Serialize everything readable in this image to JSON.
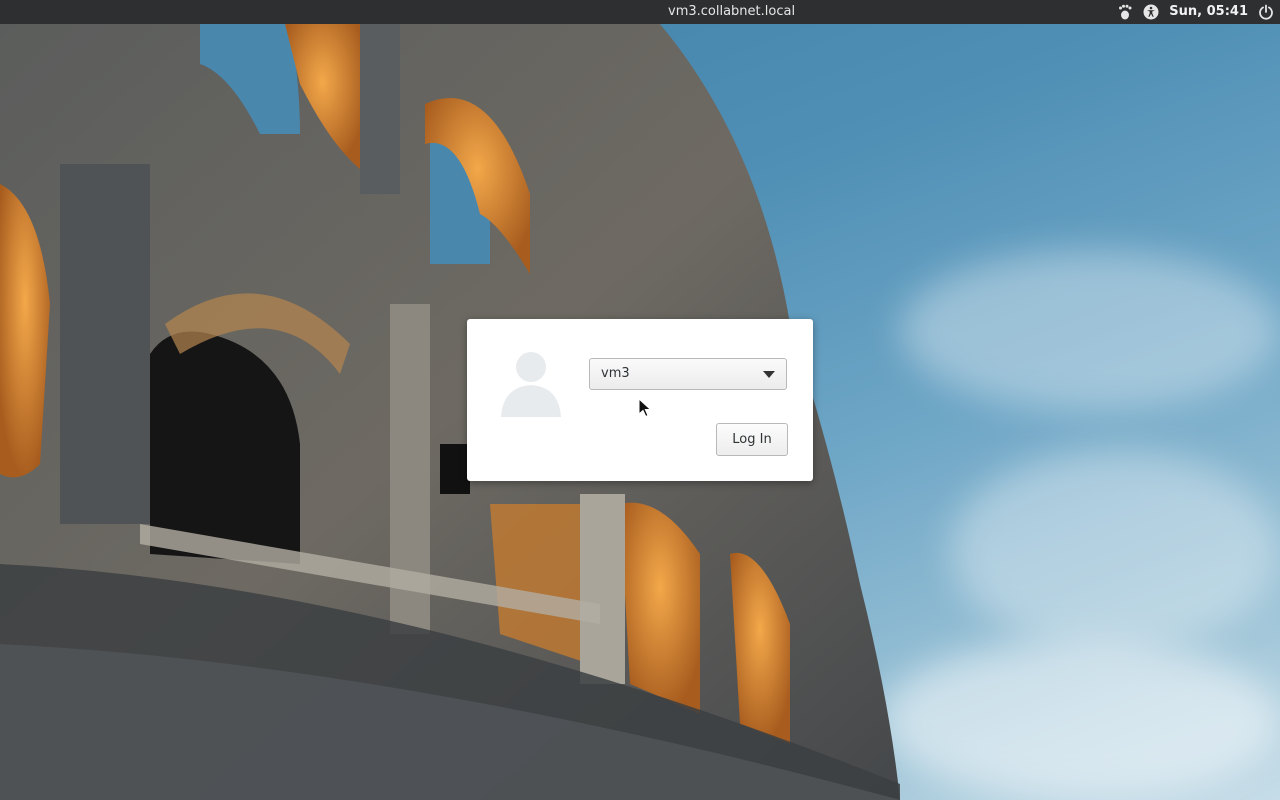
{
  "topbar": {
    "hostname": "vm3.collabnet.local",
    "clock": "Sun, 05:41",
    "icons": [
      "gnome-foot-icon",
      "accessibility-icon",
      "power-icon"
    ]
  },
  "login": {
    "selected_user": "vm3",
    "login_button_label": "Log In",
    "avatar": "user-avatar-placeholder"
  },
  "colors": {
    "topbar_bg": "#2e2f30",
    "dialog_bg": "#ffffff",
    "sky": "#4f8fb5"
  }
}
